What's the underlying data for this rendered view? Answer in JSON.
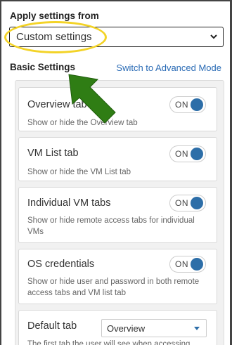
{
  "apply": {
    "label": "Apply settings from",
    "selected": "Custom settings"
  },
  "basic": {
    "title": "Basic Settings",
    "advanced_link": "Switch to Advanced Mode"
  },
  "settings": [
    {
      "title": "Overview tab",
      "desc": "Show or hide the Overview tab",
      "toggle": "ON"
    },
    {
      "title": "VM List tab",
      "desc": "Show or hide the VM List tab",
      "toggle": "ON"
    },
    {
      "title": "Individual VM tabs",
      "desc": "Show or hide remote access tabs for individual VMs",
      "toggle": "ON"
    },
    {
      "title": "OS credentials",
      "desc": "Show or hide user and password in both remote access tabs and VM list tab",
      "toggle": "ON"
    }
  ],
  "default_tab": {
    "title": "Default tab",
    "selected": "Overview",
    "desc": "The first tab the user will see when accessing"
  },
  "colors": {
    "highlight": "#f3d327",
    "arrow": "#2f7d14",
    "link": "#2a6bb5",
    "toggle_knob": "#2d6ea8"
  }
}
